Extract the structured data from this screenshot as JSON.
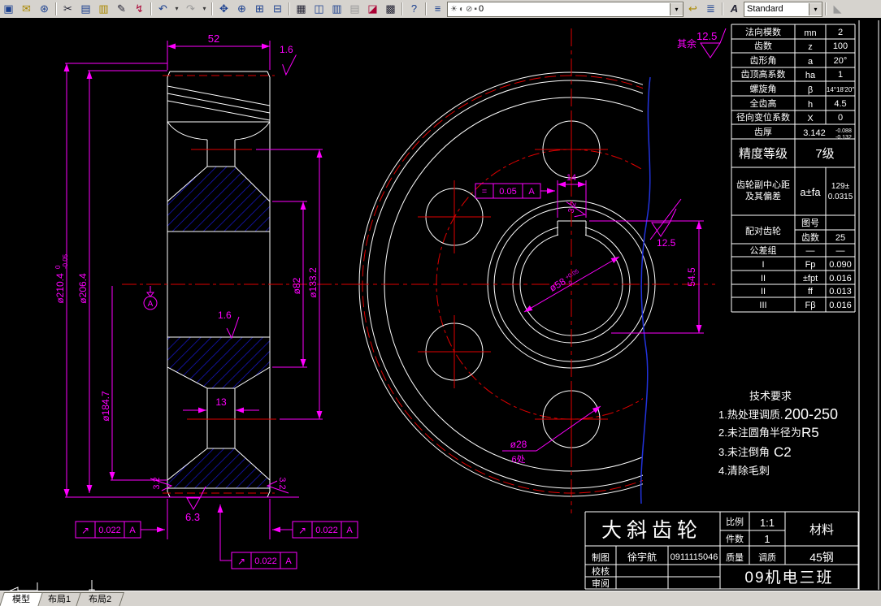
{
  "toolbar": {
    "icons": {
      "print_preview": "▣",
      "publish": "✉",
      "hyperlink": "⊛",
      "cut": "✂",
      "copy": "▤",
      "paste": "▥",
      "match_props": "✎",
      "apply": "↯",
      "undo": "↶",
      "redo": "↷",
      "pan": "✥",
      "zoom_rt": "⊕",
      "zoom_win": "⊞",
      "zoom_prev": "⊟",
      "properties": "▦",
      "design_center": "◫",
      "palettes": "▥",
      "sheetset": "▤",
      "markup": "◪",
      "calc": "▩",
      "help": "?",
      "layers": "≡",
      "bulb": "☀",
      "freeze": "◐",
      "lock": "⊘",
      "color": "▪",
      "layer_prev": "↩",
      "layer_states": "≣",
      "text_style": "A",
      "edge": "◣"
    },
    "dd": "▾",
    "layer_value": "0",
    "style_value": "Standard"
  },
  "tabs": {
    "model": "模型",
    "layout1": "布局1",
    "layout2": "布局2"
  },
  "dims": {
    "w52": "52",
    "f16": "1.6",
    "f32": "3.2",
    "f63": "6.3",
    "f125": "12.5",
    "d210": "ø210.4",
    "d210u": "0",
    "d210l": "-0.05",
    "d206": "ø206.4",
    "d184": "ø184.7",
    "d133": "ø133.2",
    "d82": "ø82",
    "w13": "13",
    "runsym": "↗",
    "runout": "0.022",
    "datum": "A",
    "k14": "14",
    "ksym": "=",
    "ktol": "0.05",
    "h545": "54.5",
    "d58": "ø58",
    "d58u": "+0.05",
    "d58l": "0",
    "d28": "ø28",
    "d28n": "6处",
    "rest_label": "其余",
    "rest_val": "12.5"
  },
  "gear_table": {
    "rows": [
      {
        "n": "法向模数",
        "s": "mn",
        "v": "2"
      },
      {
        "n": "齿数",
        "s": "z",
        "v": "100"
      },
      {
        "n": "齿形角",
        "s": "a",
        "v": "20°"
      },
      {
        "n": "齿顶高系数",
        "s": "ha",
        "v": "1"
      },
      {
        "n": "螺旋角",
        "s": "β",
        "v": "14°18′20″"
      },
      {
        "n": "全齿高",
        "s": "h",
        "v": "4.5"
      },
      {
        "n": "径向变位系数",
        "s": "X",
        "v": "0"
      }
    ],
    "thickness": {
      "n": "齿厚",
      "v": "3.142",
      "up": "-0.088",
      "lo": "-0.132"
    },
    "precision": {
      "n": "精度等级",
      "v": "7级"
    },
    "center_dist": {
      "n1": "齿轮副中心距",
      "n2": "及其偏差",
      "s": "a±fa",
      "v1": "129±",
      "v2": "0.0315"
    },
    "mate": {
      "n": "配对齿轮",
      "r1": "图号",
      "r1v": "",
      "r2": "齿数",
      "r2v": "25"
    },
    "tol_group": {
      "n": "公差组",
      "s": "—",
      "v": "—"
    },
    "tol_rows": [
      {
        "g": "I",
        "s": "Fp",
        "v": "0.090"
      },
      {
        "g": "II",
        "s": "±fpt",
        "v": "0.016"
      },
      {
        "g": "II",
        "s": "ff",
        "v": "0.013"
      },
      {
        "g": "III",
        "s": "Fβ",
        "v": "0.016"
      }
    ]
  },
  "tech_req": {
    "title": "技术要求",
    "l1a": "1.热处理调质.",
    "l1b": "200-250",
    "l2a": "2.未注圆角半径为",
    "l2b": "R5",
    "l3a": "3.未注倒角",
    "l3b": "C2",
    "l4": "4.清除毛刺"
  },
  "title_block": {
    "title": "大斜齿轮",
    "scale_l": "比例",
    "scale": "1:1",
    "qty_l": "件数",
    "qty": "1",
    "mat_l": "材料",
    "mat": "45钢",
    "drawn_l": "制图",
    "drawn": "徐宇航",
    "sid": "0911115046",
    "mass_l": "质量",
    "mass": "调质",
    "check_l": "校核",
    "review_l": "审阅",
    "cls": "09机电三班"
  }
}
